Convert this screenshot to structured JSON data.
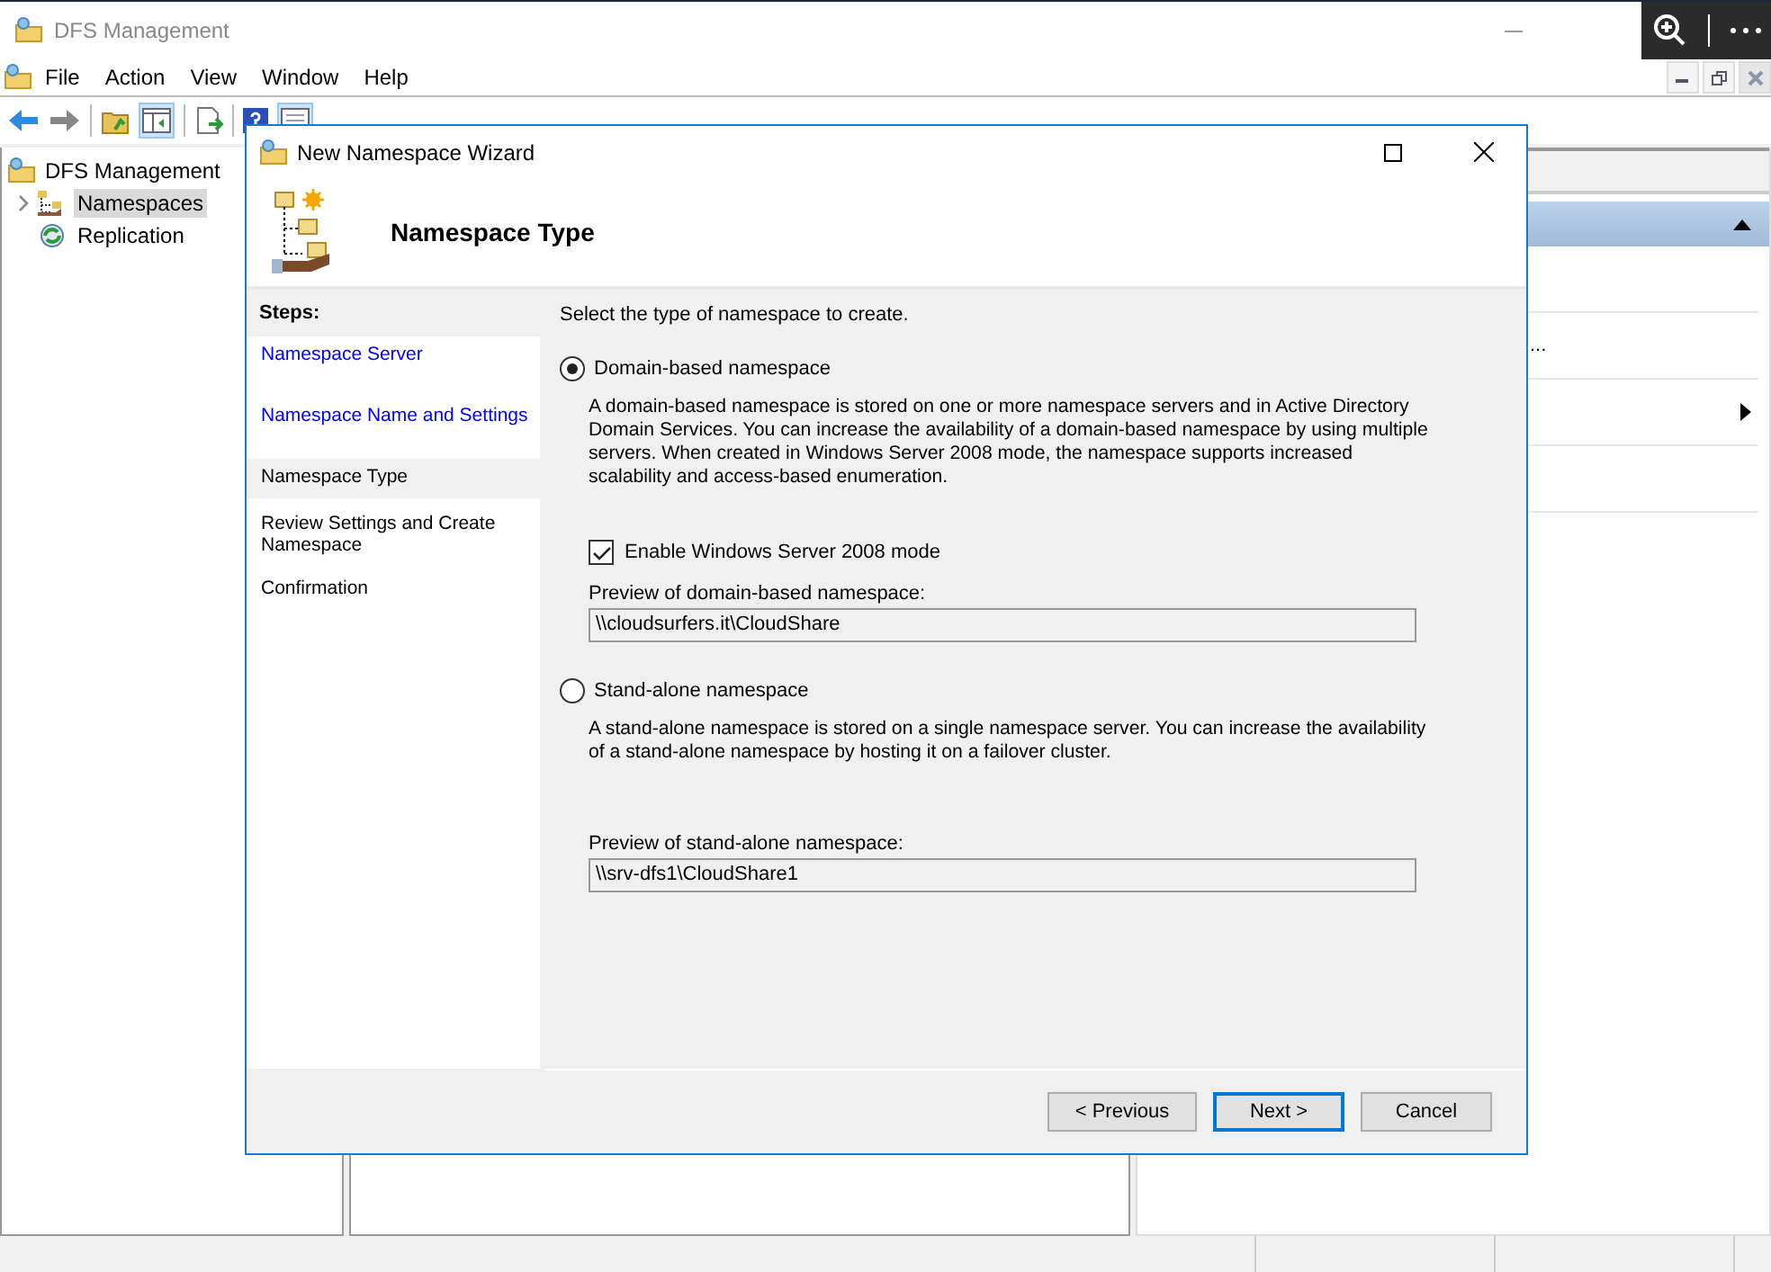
{
  "window": {
    "title": "DFS Management"
  },
  "menu": [
    "File",
    "Action",
    "View",
    "Window",
    "Help"
  ],
  "tree": [
    {
      "label": "DFS Management",
      "selected": false,
      "children": [
        {
          "label": "Namespaces",
          "selected": true,
          "expanded": false
        },
        {
          "label": "Replication",
          "selected": false
        }
      ]
    }
  ],
  "actions_pane": {
    "items": [
      {
        "label": "...",
        "kind": "text"
      },
      {
        "kind": "submenu"
      }
    ]
  },
  "dialog": {
    "title": "New Namespace Wizard",
    "heading": "Namespace Type",
    "steps_title": "Steps:",
    "steps": [
      {
        "label": "Namespace Server",
        "kind": "link",
        "selected": false
      },
      {
        "label": "Namespace Name and Settings",
        "kind": "link",
        "selected": false
      },
      {
        "label": "Namespace Type",
        "kind": "text",
        "selected": true
      },
      {
        "label": "Review Settings and Create Namespace",
        "kind": "text",
        "selected": false
      },
      {
        "label": "Confirmation",
        "kind": "text",
        "selected": false
      }
    ],
    "prompt": "Select the type of namespace to create.",
    "options": [
      {
        "label": "Domain-based namespace",
        "selected": true,
        "description": "A domain-based namespace is stored on one or more namespace servers and in Active Directory Domain Services. You can increase the availability of a domain-based namespace by using multiple servers. When created in Windows Server 2008 mode, the namespace supports increased scalability and access-based enumeration.",
        "checkbox": {
          "label": "Enable Windows Server 2008 mode",
          "checked": true
        },
        "preview_label": "Preview of domain-based namespace:",
        "preview_value": "\\\\cloudsurfers.it\\CloudShare"
      },
      {
        "label": "Stand-alone namespace",
        "selected": false,
        "description": "A stand-alone namespace is stored on a single namespace server. You can increase the availability of a stand-alone namespace by hosting it on a failover cluster.",
        "preview_label": "Preview of stand-alone namespace:",
        "preview_value": "\\\\srv-dfs1\\CloudShare1"
      }
    ],
    "buttons": [
      {
        "label": "< Previous",
        "default": false
      },
      {
        "label": "Next >",
        "default": true
      },
      {
        "label": "Cancel",
        "default": false
      }
    ]
  }
}
